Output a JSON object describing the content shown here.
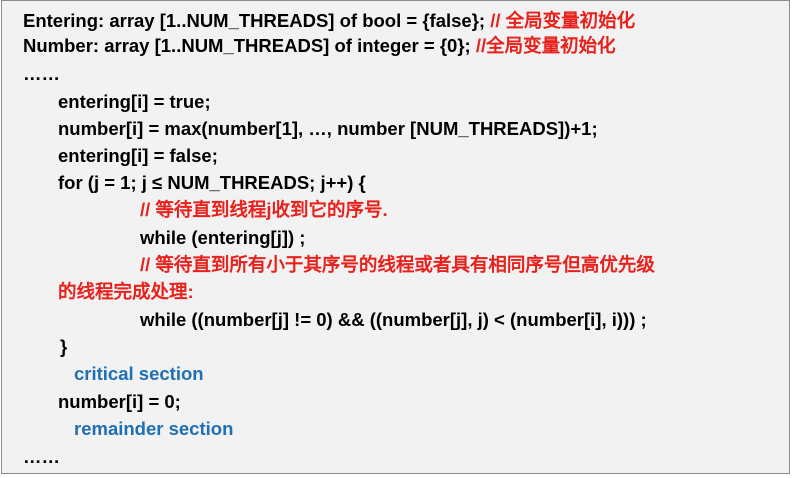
{
  "lines": {
    "l1_code": "Entering: array [1..NUM_THREADS] of bool = {false}; ",
    "l1_comment": "// 全局变量初始化",
    "l2_code": "Number: array [1..NUM_THREADS] of integer = {0};   ",
    "l2_comment": "//全局变量初始化",
    "l3": "……",
    "l4": "entering[i] = true;",
    "l5": "number[i] = max(number[1], …, number [NUM_THREADS])+1;",
    "l6": "entering[i] = false;",
    "l7": "for (j = 1; j ≤ NUM_THREADS; j++) {",
    "l8_comment": "// 等待直到线程j收到它的序号.",
    "l9": "while (entering[j]) ;",
    "l10_comment": "// 等待直到所有小于其序号的线程或者具有相同序号但高优先级",
    "l11_comment": "的线程完成处理:",
    "l12": "while ((number[j] != 0) && ((number[j], j) < (number[i], i))) ;",
    "l13": "}",
    "l14": "critical section",
    "l15": "number[i] = 0;",
    "l16": "remainder section",
    "l17": "……"
  },
  "colors": {
    "code": "#000000",
    "comment": "#e8211c",
    "section": "#1f6fb5",
    "background": "#f2f2f2"
  }
}
